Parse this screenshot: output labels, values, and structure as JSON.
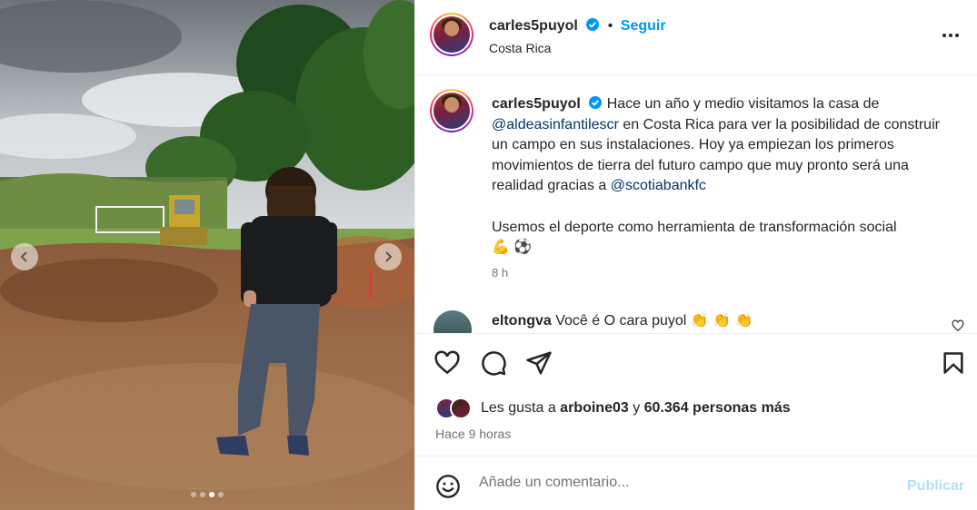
{
  "post": {
    "media": {
      "slides": 4,
      "active_slide": 3
    },
    "header": {
      "username": "carles5puyol",
      "follow_label": "Seguir",
      "location": "Costa Rica"
    },
    "caption": {
      "username": "carles5puyol",
      "text_1": " Hace un año y medio visitamos la casa de ",
      "mention_1": "@aldeasinfantilescr",
      "text_2": " en Costa Rica para ver la posibilidad de construir un campo en sus instalaciones. Hoy ya empiezan los primeros movimientos de tierra del futuro campo que muy pronto será una realidad gracias a ",
      "mention_2": "@scotiabankfc",
      "text_3": "Usemos el deporte como herramienta de transformación social",
      "emojis": "💪 ⚽",
      "time": "8 h"
    },
    "comment": {
      "username": "eltongva",
      "text": " Você é O cara puyol ",
      "emojis": "👏 👏 👏"
    },
    "likes": {
      "prefix": "Les gusta a ",
      "user": "arboine03",
      "middle": " y ",
      "count": "60.364 personas más"
    },
    "posted_ago": "Hace 9 horas",
    "add_comment": {
      "placeholder": "Añade un comentario...",
      "publish_label": "Publicar"
    }
  },
  "colors": {
    "accent": "#0095f6",
    "mention": "#00376b",
    "publish_disabled": "#b2dffc",
    "secondary_text": "#737373"
  }
}
